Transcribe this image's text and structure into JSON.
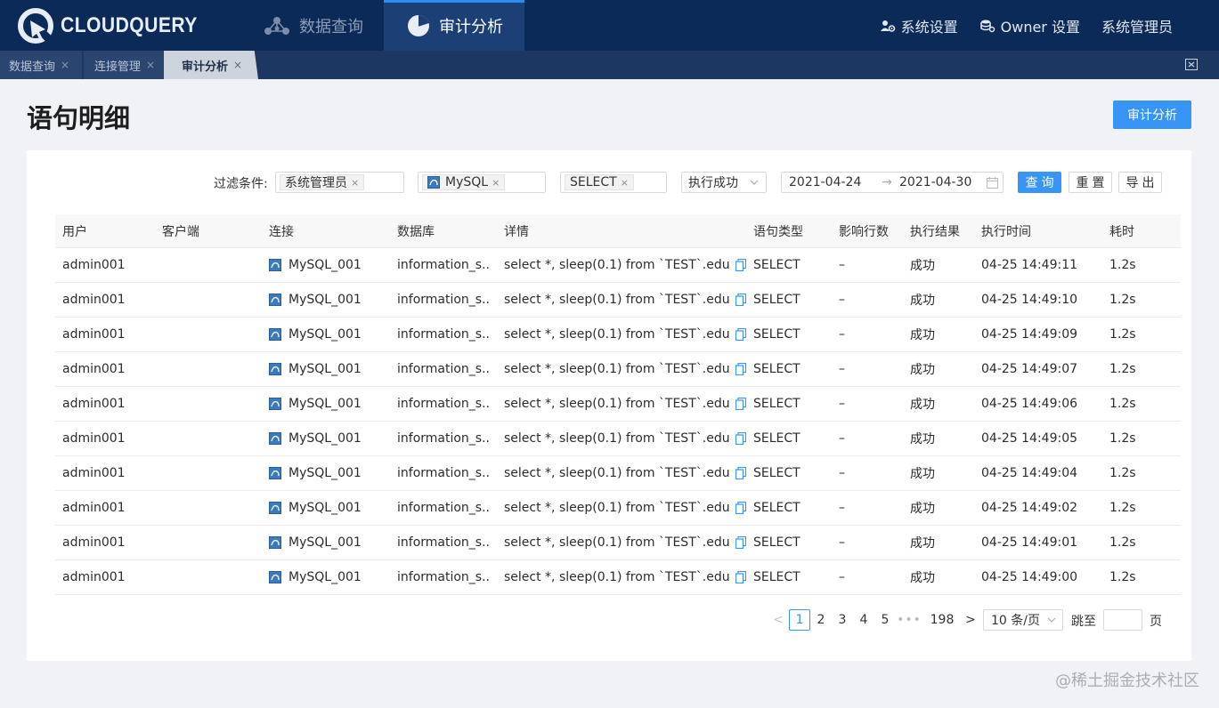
{
  "app": {
    "logo_text": "CLOUDQUERY"
  },
  "nav": {
    "data_query": "数据查询",
    "audit": "审计分析",
    "system_settings": "系统设置",
    "owner_settings": "Owner 设置",
    "admin": "系统管理员"
  },
  "tabs": [
    {
      "label": "数据查询"
    },
    {
      "label": "连接管理"
    },
    {
      "label": "审计分析"
    }
  ],
  "page": {
    "title": "语句明细",
    "audit_button": "审计分析"
  },
  "filters": {
    "label": "过滤条件:",
    "user_tag": "系统管理员",
    "conn_tag": "MySQL",
    "type_tag": "SELECT",
    "result_select": "执行成功",
    "date_from": "2021-04-24",
    "date_arrow": "→",
    "date_to": "2021-04-30",
    "query_button": "查询",
    "reset_button": "重置",
    "export_button": "导出",
    "tag_close": "×"
  },
  "table": {
    "headers": [
      "用户",
      "客户端",
      "连接",
      "数据库",
      "详情",
      "语句类型",
      "影响行数",
      "执行结果",
      "执行时间",
      "耗时"
    ],
    "rows": [
      {
        "user": "admin001",
        "client": "",
        "conn": "MySQL_001",
        "db": "information_s...",
        "detail": "select *, sleep(0.1) from `TEST`.edu",
        "type": "SELECT",
        "rows": "–",
        "result": "成功",
        "time": "04-25 14:49:11",
        "cost": "1.2s"
      },
      {
        "user": "admin001",
        "client": "",
        "conn": "MySQL_001",
        "db": "information_s...",
        "detail": "select *, sleep(0.1) from `TEST`.edu",
        "type": "SELECT",
        "rows": "–",
        "result": "成功",
        "time": "04-25 14:49:10",
        "cost": "1.2s"
      },
      {
        "user": "admin001",
        "client": "",
        "conn": "MySQL_001",
        "db": "information_s...",
        "detail": "select *, sleep(0.1) from `TEST`.edu",
        "type": "SELECT",
        "rows": "–",
        "result": "成功",
        "time": "04-25 14:49:09",
        "cost": "1.2s"
      },
      {
        "user": "admin001",
        "client": "",
        "conn": "MySQL_001",
        "db": "information_s...",
        "detail": "select *, sleep(0.1) from `TEST`.edu",
        "type": "SELECT",
        "rows": "–",
        "result": "成功",
        "time": "04-25 14:49:07",
        "cost": "1.2s"
      },
      {
        "user": "admin001",
        "client": "",
        "conn": "MySQL_001",
        "db": "information_s...",
        "detail": "select *, sleep(0.1) from `TEST`.edu",
        "type": "SELECT",
        "rows": "–",
        "result": "成功",
        "time": "04-25 14:49:06",
        "cost": "1.2s"
      },
      {
        "user": "admin001",
        "client": "",
        "conn": "MySQL_001",
        "db": "information_s...",
        "detail": "select *, sleep(0.1) from `TEST`.edu",
        "type": "SELECT",
        "rows": "–",
        "result": "成功",
        "time": "04-25 14:49:05",
        "cost": "1.2s"
      },
      {
        "user": "admin001",
        "client": "",
        "conn": "MySQL_001",
        "db": "information_s...",
        "detail": "select *, sleep(0.1) from `TEST`.edu",
        "type": "SELECT",
        "rows": "–",
        "result": "成功",
        "time": "04-25 14:49:04",
        "cost": "1.2s"
      },
      {
        "user": "admin001",
        "client": "",
        "conn": "MySQL_001",
        "db": "information_s...",
        "detail": "select *, sleep(0.1) from `TEST`.edu",
        "type": "SELECT",
        "rows": "–",
        "result": "成功",
        "time": "04-25 14:49:02",
        "cost": "1.2s"
      },
      {
        "user": "admin001",
        "client": "",
        "conn": "MySQL_001",
        "db": "information_s...",
        "detail": "select *, sleep(0.1) from `TEST`.edu",
        "type": "SELECT",
        "rows": "–",
        "result": "成功",
        "time": "04-25 14:49:01",
        "cost": "1.2s"
      },
      {
        "user": "admin001",
        "client": "",
        "conn": "MySQL_001",
        "db": "information_s...",
        "detail": "select *, sleep(0.1) from `TEST`.edu",
        "type": "SELECT",
        "rows": "–",
        "result": "成功",
        "time": "04-25 14:49:00",
        "cost": "1.2s"
      }
    ]
  },
  "pagination": {
    "prev": "<",
    "pages": [
      "1",
      "2",
      "3",
      "4",
      "5"
    ],
    "current": "1",
    "dots": "•••",
    "last": "198",
    "next": ">",
    "page_size": "10 条/页",
    "jump_label": "跳至",
    "page_label": "页"
  },
  "watermark": "@稀土掘金技术社区",
  "colors": {
    "topbar": "#0c2a57",
    "accent": "#3796f5",
    "tabbar": "#1c3761"
  },
  "icons": {
    "logo": "cloudquery-logo-icon",
    "data_query": "network-nodes-icon",
    "audit": "pie-chart-icon",
    "system_settings": "users-gear-icon",
    "owner_settings": "database-gear-icon",
    "db": "mysql-icon",
    "copy": "copy-icon",
    "calendar": "calendar-icon",
    "close_all": "close-all-tabs-icon"
  }
}
